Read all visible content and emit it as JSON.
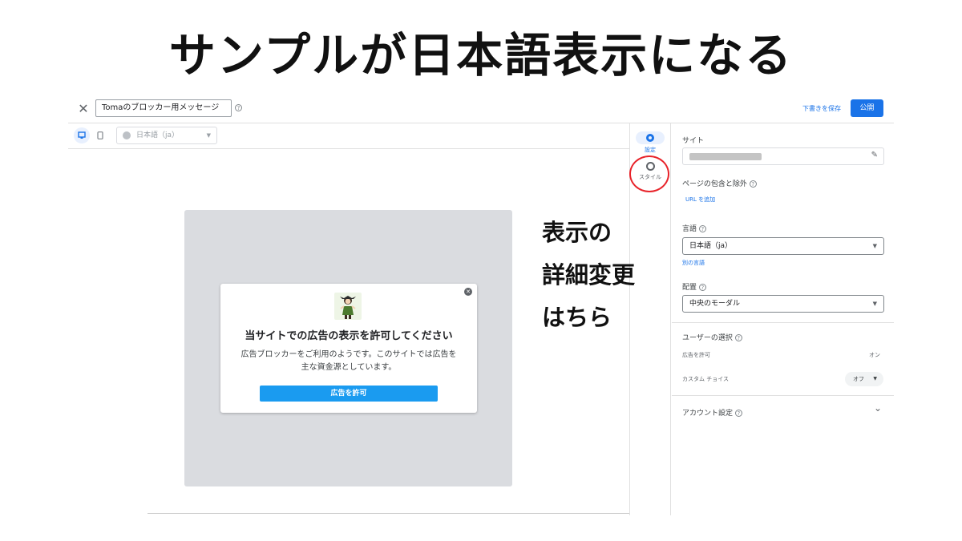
{
  "headline": "サンプルが日本語表示になる",
  "annotation": [
    "表示の",
    "詳細変更",
    "はちら"
  ],
  "topbar": {
    "close_icon": "close-icon",
    "message_name": "Tomaのブロッカー用メッセージ",
    "save_draft": "下書きを保存",
    "publish": "公開"
  },
  "toolbar": {
    "language": "日本語（ja）"
  },
  "preview": {
    "title": "当サイトでの広告の表示を許可してください",
    "body_line1": "広告ブロッカーをご利用のようです。このサイトでは広告を",
    "body_line2": "主な資金源としています。",
    "allow_button": "広告を許可"
  },
  "rail": {
    "settings_label": "設定",
    "style_label": "スタイル"
  },
  "panel": {
    "site_label": "サイト",
    "page_include_label": "ページの包含と除外",
    "add_url": "URL を追加",
    "language_label": "言語",
    "language_value": "日本語（ja）",
    "other_language": "別の言語",
    "placement_label": "配置",
    "placement_value": "中央のモーダル",
    "user_choice_label": "ユーザーの選択",
    "allow_ads_label": "広告を許可",
    "allow_ads_value": "オン",
    "custom_choice_label": "カスタム チョイス",
    "custom_choice_value": "オフ",
    "account_settings_label": "アカウント設定"
  },
  "colors": {
    "accent": "#1a73e8",
    "allow_button": "#1a9bf0",
    "highlight_ring": "#e8232a",
    "preview_background": "#dadce0"
  }
}
